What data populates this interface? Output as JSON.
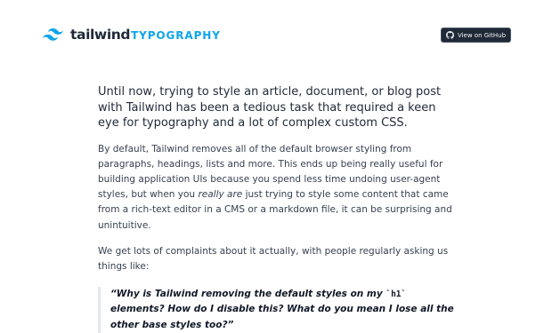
{
  "header": {
    "brand_name": "tailwind",
    "brand_sub": "TYPOGRAPHY",
    "logo_icon": "tailwind-logo-icon",
    "github_button_label": "View on GitHub",
    "github_icon": "github-icon"
  },
  "article": {
    "lead": "Until now, trying to style an article, document, or blog post with Tailwind has been a tedious task that required a keen eye for typography and a lot of complex custom CSS.",
    "para1_before": "By default, Tailwind removes all of the default browser styling from paragraphs, headings, lists and more. This ends up being really useful for building application UIs because you spend less time undoing user-agent styles, but when you ",
    "para1_emphasis": "really are",
    "para1_after": " just trying to style some content that came from a rich-text editor in a CMS or a markdown file, it can be surprising and unintuitive.",
    "para2": "We get lots of complaints about it actually, with people regularly asking us things like:",
    "quote_before": "“Why is Tailwind removing the default styles on my ",
    "quote_code": "`h1`",
    "quote_after": " elements? How do I disable this? What do you mean I lose all the other base styles too?”"
  },
  "colors": {
    "accent": "#0ea5e9",
    "text_dark": "#1f2937",
    "button_bg": "#1f2937"
  }
}
